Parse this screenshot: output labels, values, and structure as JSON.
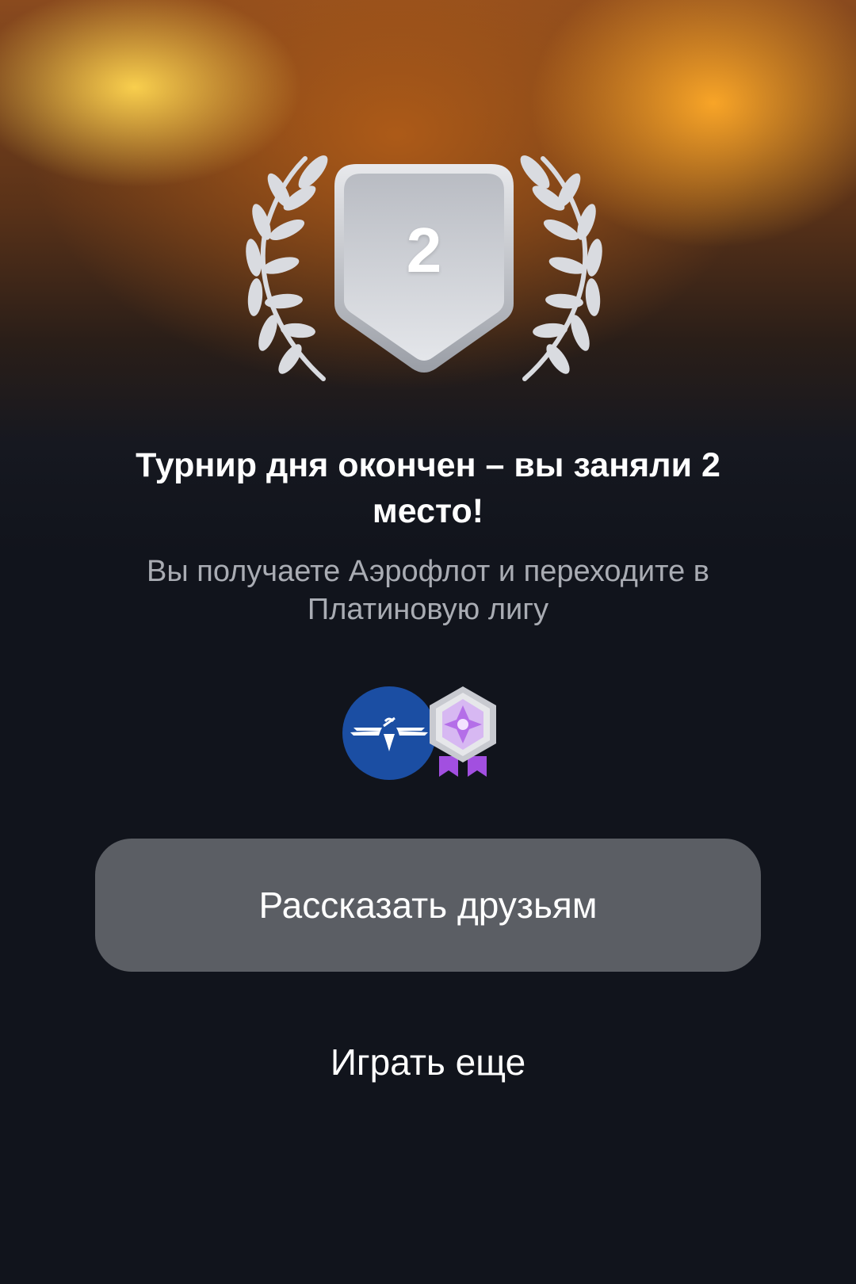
{
  "result": {
    "place_number": "2",
    "title": "Турнир дня окончен – вы заняли 2 место!",
    "subtitle": "Вы получаете Аэрофлот и переходите в Платиновую лигу"
  },
  "rewards": [
    {
      "icon": "aeroflot-logo-icon"
    },
    {
      "icon": "platinum-league-badge-icon"
    }
  ],
  "actions": {
    "share_label": "Рассказать друзьям",
    "play_again_label": "Играть еще"
  },
  "colors": {
    "background": "#11141c",
    "share_button": "#5b5e64",
    "airline_blue": "#1b4ea3",
    "league_purple": "#b46ee8"
  }
}
